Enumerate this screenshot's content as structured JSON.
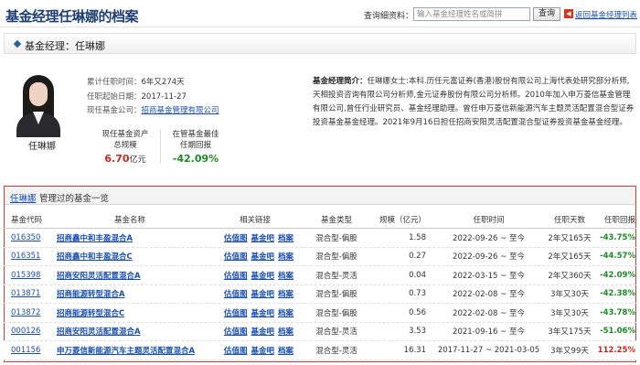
{
  "header": {
    "title": "基金经理任琳娜的档案",
    "query_label": "查询细资料：",
    "search_placeholder": "输入基金经理姓名或简拼",
    "search_button": "查询",
    "back_link": "返回基金经理列表"
  },
  "section": {
    "label": "基金经理：",
    "name": "任琳娜"
  },
  "profile": {
    "name": "任琳娜",
    "tenure_label": "累计任职时间：",
    "tenure_value": "6年又274天",
    "start_label": "任职起始日期：",
    "start_value": "2017-11-27",
    "company_label": "现任基金公司：",
    "company_value": "招商基金管理有限公司",
    "aum_label_1": "现任基金资产",
    "aum_label_2": "总规模",
    "aum_value": "6.70",
    "aum_unit": "亿元",
    "best_label_1": "在管基金最佳",
    "best_label_2": "任期回报",
    "best_value": "-42.09%"
  },
  "bio": {
    "label": "基金经理简介：",
    "text": "任琳娜女士:本科.历任元富证券(香港)股份有限公司上海代表处研究部分析师,天相投资咨询有限公司分析师,金元证券股份有限公司分析师。2010年加入申万菱信基金管理有限公司,曾任行业研究员、基金经理助理。曾任申万菱信新能源汽车主题灵活配置混合型证券投资基金基金经理。2021年9月16日担任招商安阳灵活配置混合型证券投资基金基金经理。"
  },
  "fund_list": {
    "manager_name": "任琳娜",
    "title_suffix": "管理过的基金一览",
    "columns": [
      "基金代码",
      "基金名称",
      "相关链接",
      "基金类型",
      "规模（亿元）",
      "任职时间",
      "任职天数",
      "任职回报"
    ],
    "link_labels": [
      "估值图",
      "基金吧",
      "档案"
    ],
    "rows": [
      {
        "code": "016350",
        "name": "招商鑫中和丰盈混合A",
        "type": "混合型-偏股",
        "scale": "1.58",
        "period": "2022-09-26 ~ 至今",
        "days": "2年又165天",
        "ret": "-43.75%",
        "color": "#1b8c24"
      },
      {
        "code": "016351",
        "name": "招商鑫中和丰盈混合C",
        "type": "混合型-偏股",
        "scale": "0.27",
        "period": "2022-09-26 ~ 至今",
        "days": "2年又165天",
        "ret": "-44.57%",
        "color": "#1b8c24"
      },
      {
        "code": "015398",
        "name": "招商安阳灵活配置混合A",
        "type": "混合型-灵活",
        "scale": "0.04",
        "period": "2022-03-15 ~ 至今",
        "days": "2年又360天",
        "ret": "-42.09%",
        "color": "#1b8c24"
      },
      {
        "code": "013871",
        "name": "招商能源转型混合A",
        "type": "混合型-偏股",
        "scale": "0.73",
        "period": "2022-02-08 ~ 至今",
        "days": "3年又30天",
        "ret": "-42.38%",
        "color": "#1b8c24"
      },
      {
        "code": "013872",
        "name": "招商能源转型混合C",
        "type": "混合型-偏股",
        "scale": "0.56",
        "period": "2022-02-08 ~ 至今",
        "days": "3年又30天",
        "ret": "-43.78%",
        "color": "#1b8c24"
      },
      {
        "code": "000126",
        "name": "招商安阳灵活配置混合A",
        "type": "混合型-灵活",
        "scale": "3.53",
        "period": "2021-09-16 ~ 至今",
        "days": "3年又175天",
        "ret": "-51.06%",
        "color": "#1b8c24"
      },
      {
        "code": "001156",
        "name": "申万菱信新能源汽车主题灵活配置混合A",
        "type": "混合型-灵活",
        "scale": "16.31",
        "period": "2017-11-27 ~ 2021-03-05",
        "days": "3年又99天",
        "ret": "112.25%",
        "color": "#c8281d"
      }
    ]
  }
}
